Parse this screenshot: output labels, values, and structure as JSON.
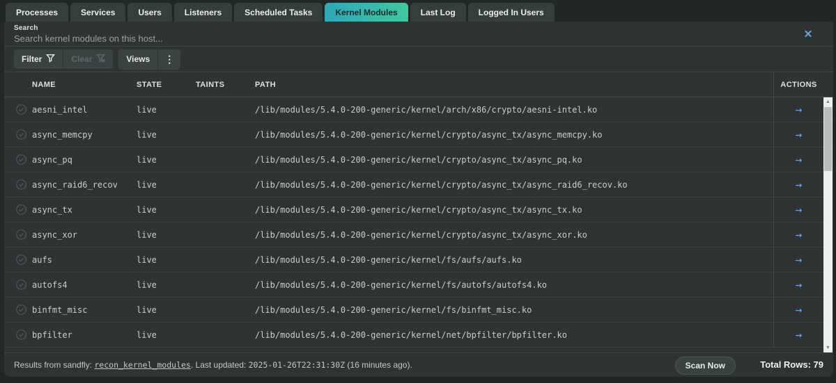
{
  "tabs": [
    {
      "label": "Processes",
      "active": false
    },
    {
      "label": "Services",
      "active": false
    },
    {
      "label": "Users",
      "active": false
    },
    {
      "label": "Listeners",
      "active": false
    },
    {
      "label": "Scheduled Tasks",
      "active": false
    },
    {
      "label": "Kernel Modules",
      "active": true
    },
    {
      "label": "Last Log",
      "active": false
    },
    {
      "label": "Logged In Users",
      "active": false
    }
  ],
  "search": {
    "label": "Search",
    "placeholder": "Search kernel modules on this host...",
    "close_icon": "✕"
  },
  "toolbar": {
    "filter_label": "Filter",
    "clear_label": "Clear",
    "views_label": "Views",
    "kebab_icon": "⋮"
  },
  "table": {
    "columns": [
      "NAME",
      "STATE",
      "TAINTS",
      "PATH",
      "ACTIONS"
    ],
    "row_action_icon": "→",
    "rows": [
      {
        "name": "aesni_intel",
        "state": "live",
        "taints": "",
        "path": "/lib/modules/5.4.0-200-generic/kernel/arch/x86/crypto/aesni-intel.ko"
      },
      {
        "name": "async_memcpy",
        "state": "live",
        "taints": "",
        "path": "/lib/modules/5.4.0-200-generic/kernel/crypto/async_tx/async_memcpy.ko"
      },
      {
        "name": "async_pq",
        "state": "live",
        "taints": "",
        "path": "/lib/modules/5.4.0-200-generic/kernel/crypto/async_tx/async_pq.ko"
      },
      {
        "name": "async_raid6_recov",
        "state": "live",
        "taints": "",
        "path": "/lib/modules/5.4.0-200-generic/kernel/crypto/async_tx/async_raid6_recov.ko"
      },
      {
        "name": "async_tx",
        "state": "live",
        "taints": "",
        "path": "/lib/modules/5.4.0-200-generic/kernel/crypto/async_tx/async_tx.ko"
      },
      {
        "name": "async_xor",
        "state": "live",
        "taints": "",
        "path": "/lib/modules/5.4.0-200-generic/kernel/crypto/async_tx/async_xor.ko"
      },
      {
        "name": "aufs",
        "state": "live",
        "taints": "",
        "path": "/lib/modules/5.4.0-200-generic/kernel/fs/aufs/aufs.ko"
      },
      {
        "name": "autofs4",
        "state": "live",
        "taints": "",
        "path": "/lib/modules/5.4.0-200-generic/kernel/fs/autofs/autofs4.ko"
      },
      {
        "name": "binfmt_misc",
        "state": "live",
        "taints": "",
        "path": "/lib/modules/5.4.0-200-generic/kernel/fs/binfmt_misc.ko"
      },
      {
        "name": "bpfilter",
        "state": "live",
        "taints": "",
        "path": "/lib/modules/5.4.0-200-generic/kernel/net/bpfilter/bpfilter.ko"
      }
    ]
  },
  "footer": {
    "results_prefix": "Results from sandfly: ",
    "source_name": "recon_kernel_modules",
    "updated_label": ". Last updated: ",
    "timestamp": "2025-01-26T22:31:30Z",
    "ago_text": " (16 minutes ago).",
    "scan_button": "Scan Now",
    "total_rows_label": "Total Rows: 79"
  },
  "colors": {
    "active_tab_gradient_start": "#2fa7b8",
    "active_tab_gradient_end": "#41c79f",
    "panel_bg": "#2e3434",
    "page_bg": "#212627",
    "accent_blue": "#74a3d6",
    "close_blue": "#6fa3d8",
    "row_text": "#c7cdcd"
  }
}
